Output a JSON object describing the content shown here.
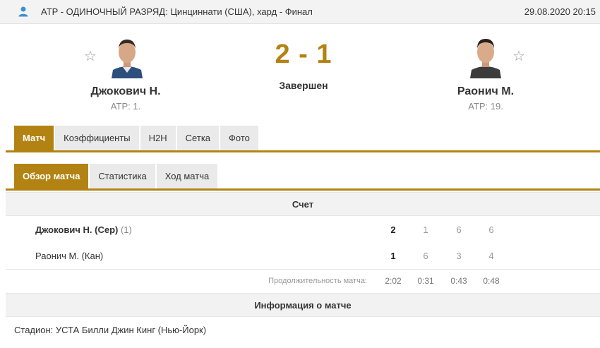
{
  "header": {
    "title": "ATP - ОДИНОЧНЫЙ РАЗРЯД: Цинциннати (США), хард - Финал",
    "datetime": "29.08.2020 20:15",
    "icon": "person-icon"
  },
  "match": {
    "score": "2 - 1",
    "status": "Завершен",
    "home": {
      "name": "Джокович Н.",
      "rank": "ATP: 1."
    },
    "away": {
      "name": "Раонич М.",
      "rank": "ATP: 19."
    }
  },
  "tabs": [
    "Матч",
    "Коэффициенты",
    "H2H",
    "Сетка",
    "Фото"
  ],
  "subtabs": [
    "Обзор матча",
    "Статистика",
    "Ход матча"
  ],
  "score_section": {
    "title": "Счет",
    "rows": [
      {
        "name": "Джокович Н. (Сер)",
        "seed": "(1)",
        "total": "2",
        "sets": [
          "1",
          "6",
          "6"
        ]
      },
      {
        "name": "Раонич М. (Кан)",
        "seed": "",
        "total": "1",
        "sets": [
          "6",
          "3",
          "4"
        ]
      }
    ],
    "duration_label": "Продолжительность матча:",
    "durations": [
      "2:02",
      "0:31",
      "0:43",
      "0:48"
    ]
  },
  "info_section": {
    "title": "Информация о матче",
    "stadium": "Стадион: УСТА Билли Джин Кинг (Нью-Йорк)"
  },
  "colors": {
    "accent": "#b28312",
    "bar": "#f2f2f2"
  }
}
